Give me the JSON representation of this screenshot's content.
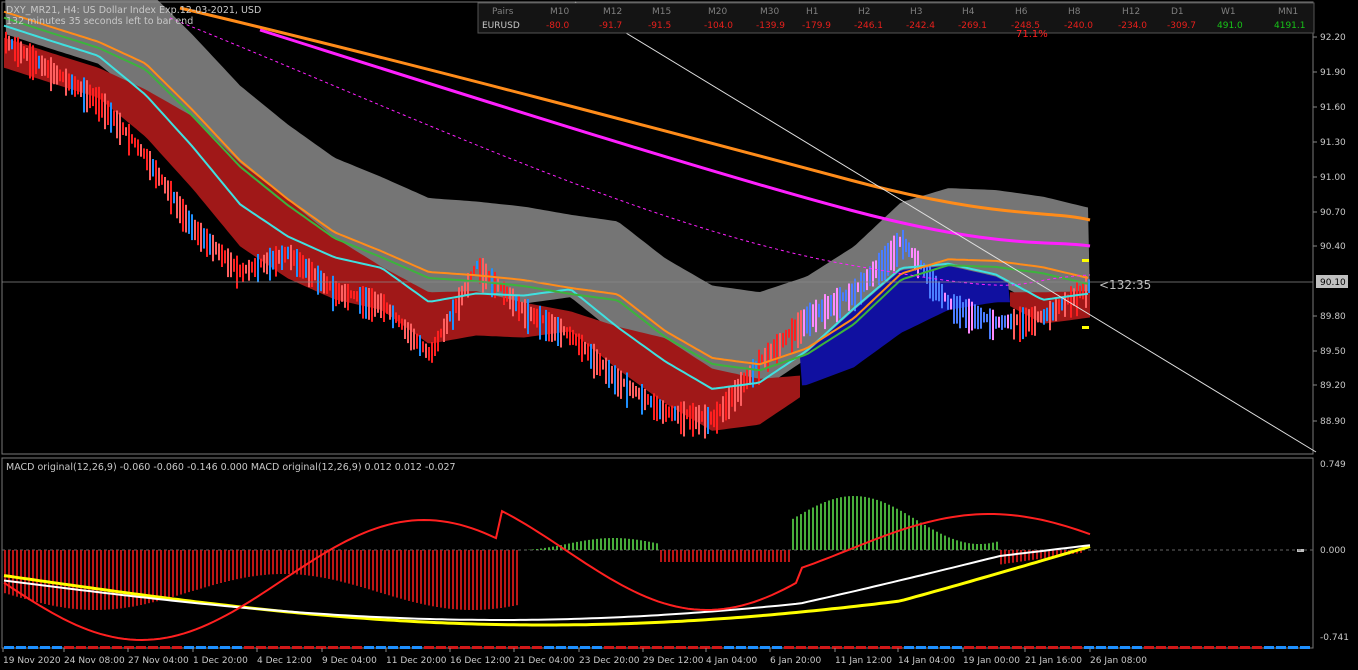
{
  "chart_header": {
    "title": "DXY_MR21, H4:  US Dollar Index Exp.12-03-2021, USD",
    "countdown_text": "132 minutes 35 seconds left to bar end"
  },
  "current_price_label": "90.10",
  "timer_label": "<132:35",
  "trend_label": "71.1%",
  "price_axis": [
    "92.20",
    "91.90",
    "91.60",
    "91.30",
    "91.00",
    "90.70",
    "90.40",
    "90.10",
    "89.80",
    "89.50",
    "89.20",
    "88.90"
  ],
  "macd_axis": [
    "0.749",
    "0.000",
    "-0.741"
  ],
  "time_axis": [
    "19 Nov 2020",
    "24 Nov 08:00",
    "27 Nov 04:00",
    "1 Dec 20:00",
    "4 Dec 12:00",
    "9 Dec 04:00",
    "11 Dec 20:00",
    "16 Dec 12:00",
    "21 Dec 04:00",
    "23 Dec 20:00",
    "29 Dec 12:00",
    "4 Jan 04:00",
    "6 Jan 20:00",
    "11 Jan 12:00",
    "14 Jan 04:00",
    "19 Jan 00:00",
    "21 Jan 16:00",
    "26 Jan 08:00"
  ],
  "macd_label": "MACD original(12,26,9) -0.060 -0.060 -0.146 0.000 MACD original(12,26,9) 0.012 0.012 -0.027",
  "strength_table": {
    "headers": [
      "Pairs",
      "M10",
      "M12",
      "M15",
      "M20",
      "M30",
      "H1",
      "H2",
      "H3",
      "H4",
      "H6",
      "H8",
      "H12",
      "D1",
      "W1",
      "MN1"
    ],
    "row_label": "EURUSD",
    "values": [
      "-80.0",
      "-91.7",
      "-91.5",
      "-104.0",
      "-139.9",
      "-179.9",
      "-246.1",
      "-242.4",
      "-269.1",
      "-248.5",
      "-240.0",
      "-234.0",
      "-309.7",
      "491.0",
      "4191.1"
    ],
    "colors": [
      "#e8201c",
      "#e8201c",
      "#e8201c",
      "#e8201c",
      "#e8201c",
      "#e8201c",
      "#e8201c",
      "#e8201c",
      "#e8201c",
      "#e8201c",
      "#e8201c",
      "#e8201c",
      "#e8201c",
      "#18c418",
      "#18c418"
    ]
  },
  "colors": {
    "background": "#000000",
    "grid": "#555555",
    "bull": "#1e90ff",
    "bear": "#ff2020",
    "ma_orange": "#ff8c1a",
    "ma_magenta": "#ff20ff",
    "ma_cyan": "#40e0e0",
    "ma_green": "#3cb43c",
    "cloud_gray": "#8a8a8a",
    "ribbon_red": "#a01818",
    "ribbon_blue": "#1010a0",
    "macd_green": "#50c040",
    "macd_red": "#d01818",
    "macd_yellow": "#ffff00",
    "macd_white": "#ffffff"
  },
  "chart_data": {
    "type": "line",
    "title": "DXY_MR21, H4:  US Dollar Index Exp.12-03-2021, USD",
    "ylim": [
      88.75,
      92.3
    ],
    "series": [
      {
        "values": [
          92.02,
          91.78,
          91.55,
          91.1,
          90.55,
          90.2,
          90.35,
          90.05,
          89.95,
          89.55,
          90.25,
          89.9,
          89.7,
          89.35,
          89.1,
          89.05,
          89.5,
          89.85,
          90.05,
          90.45,
          89.95,
          89.8,
          89.85,
          90.1
        ]
      }
    ]
  }
}
